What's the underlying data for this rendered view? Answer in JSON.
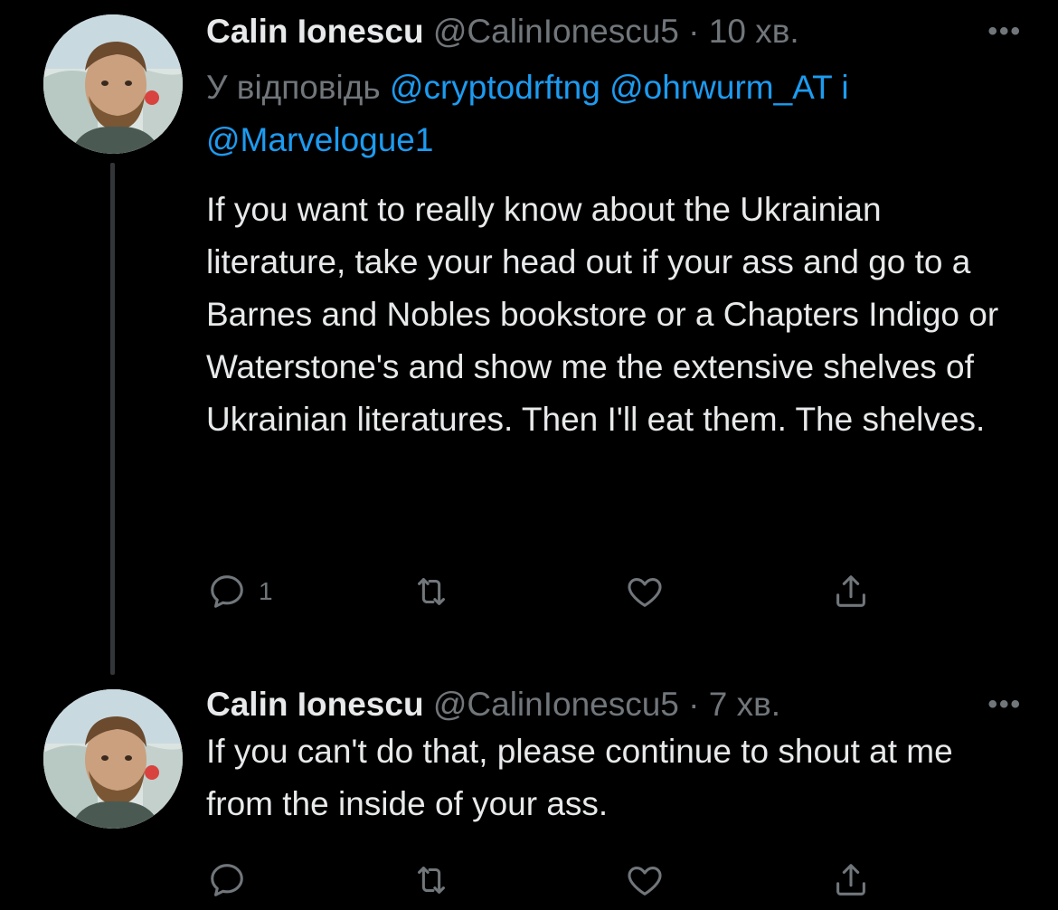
{
  "tweets": [
    {
      "author": {
        "name": "Calin Ionescu",
        "handle": "@CalinIonescu5"
      },
      "separator": "·",
      "time": "10 хв.",
      "more_label": "•••",
      "reply_prefix": "У відповідь",
      "mentions": [
        "@cryptodrftng",
        "@ohrwurm_AT",
        "@Marvelogue1"
      ],
      "mention_joiner": "і",
      "text": "If you want to really know about the Ukrainian literature, take your head out if your ass and go to a Barnes and Nobles bookstore or a Chapters Indigo or Waterstone's and show me the extensive shelves of Ukrainian literatures. Then I'll eat them. The shelves.",
      "reply_count": "1"
    },
    {
      "author": {
        "name": "Calin Ionescu",
        "handle": "@CalinIonescu5"
      },
      "separator": "·",
      "time": "7 хв.",
      "more_label": "•••",
      "text": "If you can't do that, please continue to shout at me from the inside of your ass."
    }
  ],
  "icons": {
    "reply": "reply-bubble-icon",
    "retweet": "retweet-icon",
    "like": "heart-icon",
    "share": "share-upload-icon"
  },
  "colors": {
    "background": "#000000",
    "text": "#e7e9ea",
    "secondary": "#71767b",
    "link": "#1d9bf0",
    "thread_line": "#333639"
  }
}
